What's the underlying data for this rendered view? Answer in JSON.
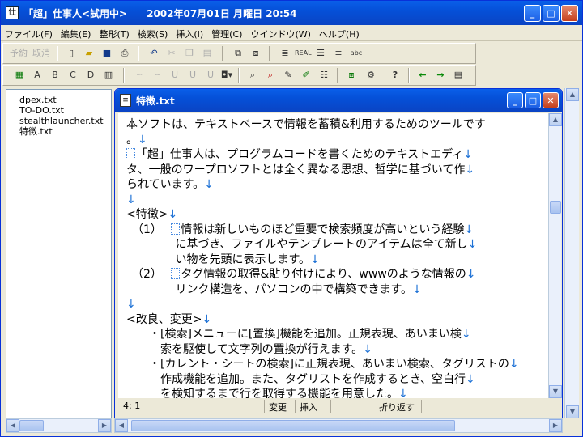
{
  "app": {
    "title": "「超」仕事人<試用中>　　2002年07月01日 月曜日 20:54"
  },
  "window_buttons": {
    "minimize": "_",
    "maximize": "□",
    "close": "✕"
  },
  "menu": [
    "ファイル(F)",
    "編集(E)",
    "整形(T)",
    "検索(S)",
    "挿入(I)",
    "管理(C)",
    "ウインドウ(W)",
    "ヘルプ(H)"
  ],
  "toolbar1": {
    "yoyaku": "予約",
    "torikeshi": "取消"
  },
  "files": [
    "dpex.txt",
    "TO-DO.txt",
    "stealthlauncher.txt",
    "特徴.txt"
  ],
  "child": {
    "title": "特徴.txt"
  },
  "editor_lines": [
    {
      "text": "本ソフトは、テキストベースで情報を蓄積&利用するためのツールです",
      "arrow": false
    },
    {
      "text": "。",
      "arrow": true
    },
    {
      "text": "「超」仕事人は、プログラムコードを書くためのテキストエディ",
      "arrow": true,
      "mark": true
    },
    {
      "text": "タ、一般のワープロソフトとは全く異なる思想、哲学に基づいて作",
      "arrow": true
    },
    {
      "text": "られています。",
      "arrow": true
    },
    {
      "text": "",
      "arrow": true
    },
    {
      "text": "<特徴>",
      "arrow": true
    },
    {
      "text": "　（1）　 情報は新しいものほど重要で検索頻度が高いという経験",
      "arrow": true,
      "mark": true
    },
    {
      "text": "　　　　 に基づき、ファイルやテンプレートのアイテムは全て新し",
      "arrow": true
    },
    {
      "text": "　　　　 い物を先頭に表示します。",
      "arrow": true
    },
    {
      "text": "　（2）　 タグ情報の取得&貼り付けにより、wwwのような情報の",
      "arrow": true,
      "mark": true
    },
    {
      "text": "　　　　 リンク構造を、パソコンの中で構築できます。",
      "arrow": true
    },
    {
      "text": "",
      "arrow": true
    },
    {
      "text": "<改良、変更>",
      "arrow": true
    },
    {
      "text": "　　・[検索]メニューに[置換]機能を追加。正規表現、あいまい検",
      "arrow": true
    },
    {
      "text": "　　　索を駆使して文字列の置換が行えます。",
      "arrow": true
    },
    {
      "text": "　　・[カレント・シートの検索]に正規表現、あいまい検索、タグリストの",
      "arrow": true
    },
    {
      "text": "　　　作成機能を追加。また、タグリストを作成するとき、空白行",
      "arrow": true
    },
    {
      "text": "　　　を検知するまで行を取得する機能を用意した。",
      "arrow": true
    }
  ],
  "arrow_glyph": "↓",
  "status": {
    "position": "4:  1",
    "mode1": "変更",
    "mode2": "挿入",
    "wrap": "折り返す"
  },
  "colors": {
    "title_blue": "#0a5fe9",
    "arrow_blue": "#1e72d6"
  }
}
